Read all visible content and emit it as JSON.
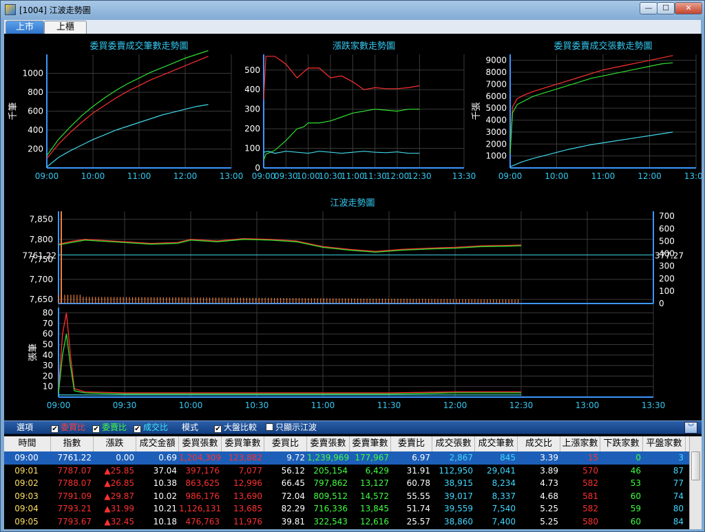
{
  "window": {
    "title": "[1004] 江波走勢圖",
    "min_label": "—",
    "max_label": "☐",
    "close_label": "✕"
  },
  "tabs": [
    {
      "label": "上市"
    },
    {
      "label": "上櫃"
    }
  ],
  "colors": {
    "red": "#ff3030",
    "green": "#30e030",
    "cyan": "#40d8e8",
    "axis": "#3c96ff",
    "title": "#34c8f0",
    "grid": "#3a3a3a",
    "orange": "#f0803a"
  },
  "chart_data": [
    {
      "type": "line",
      "title": "委買委賣成交筆數走勢圖",
      "ylabel": "千筆",
      "x_ticks": [
        "09:00",
        "10:00",
        "11:00",
        "12:00",
        "13:00"
      ],
      "ylim": [
        0,
        1200
      ],
      "y_ticks": [
        200,
        400,
        600,
        800,
        1000
      ],
      "series": [
        {
          "color": "green",
          "x": [
            0,
            0.25,
            0.5,
            0.75,
            1,
            1.25,
            1.5,
            1.75,
            2,
            2.25,
            2.5,
            2.75,
            3,
            3.25,
            3.5
          ],
          "y": [
            130,
            300,
            430,
            550,
            650,
            740,
            820,
            890,
            950,
            1010,
            1060,
            1110,
            1160,
            1200,
            1240
          ]
        },
        {
          "color": "red",
          "x": [
            0,
            0.25,
            0.5,
            0.75,
            1,
            1.25,
            1.5,
            1.75,
            2,
            2.25,
            2.5,
            2.75,
            3,
            3.25,
            3.5
          ],
          "y": [
            100,
            250,
            370,
            480,
            580,
            660,
            740,
            810,
            870,
            930,
            980,
            1030,
            1080,
            1130,
            1180
          ]
        },
        {
          "color": "cyan",
          "x": [
            0,
            0.25,
            0.5,
            0.75,
            1,
            1.25,
            1.5,
            1.75,
            2,
            2.25,
            2.5,
            2.75,
            3,
            3.25,
            3.5
          ],
          "y": [
            10,
            110,
            180,
            240,
            300,
            350,
            400,
            440,
            480,
            520,
            560,
            590,
            620,
            650,
            670
          ]
        }
      ]
    },
    {
      "type": "line",
      "title": "漲跌家數走勢圖",
      "x_ticks": [
        "09:00",
        "09:30",
        "10:00",
        "10:30",
        "11:00",
        "11:30",
        "12:00",
        "12:30",
        "13:30"
      ],
      "ylim": [
        0,
        580
      ],
      "y_ticks": [
        0,
        100,
        200,
        300,
        400,
        500
      ],
      "series": [
        {
          "color": "red",
          "x": [
            0,
            0.05,
            0.25,
            0.5,
            0.75,
            0.9,
            1,
            1.25,
            1.5,
            1.75,
            2,
            2.25,
            2.5,
            2.75,
            3,
            3.25,
            3.5
          ],
          "y": [
            350,
            570,
            570,
            530,
            460,
            490,
            510,
            510,
            460,
            470,
            440,
            400,
            410,
            405,
            405,
            410,
            420
          ]
        },
        {
          "color": "green",
          "x": [
            0,
            0.05,
            0.25,
            0.5,
            0.75,
            0.9,
            1,
            1.25,
            1.5,
            1.75,
            2,
            2.25,
            2.5,
            2.75,
            3,
            3.25,
            3.5
          ],
          "y": [
            40,
            70,
            90,
            140,
            200,
            210,
            230,
            230,
            240,
            260,
            280,
            290,
            300,
            295,
            290,
            300,
            300
          ]
        },
        {
          "color": "cyan",
          "x": [
            0,
            0.1,
            0.25,
            0.5,
            0.75,
            1,
            1.25,
            1.5,
            1.75,
            2,
            2.25,
            2.5,
            2.75,
            3,
            3.25,
            3.5
          ],
          "y": [
            80,
            85,
            75,
            85,
            80,
            75,
            85,
            80,
            75,
            80,
            85,
            80,
            78,
            82,
            75,
            75
          ]
        }
      ]
    },
    {
      "type": "line",
      "title": "委買委賣成交張數走勢圖",
      "ylabel": "千張",
      "x_ticks": [
        "09:00",
        "10:00",
        "11:00",
        "12:00",
        "13:00"
      ],
      "ylim": [
        0,
        9500
      ],
      "y_ticks": [
        1000,
        2000,
        3000,
        4000,
        5000,
        6000,
        7000,
        8000,
        9000
      ],
      "series": [
        {
          "color": "red",
          "x": [
            0,
            0.05,
            0.15,
            0.3,
            0.5,
            0.75,
            1,
            1.25,
            1.5,
            1.75,
            2,
            2.25,
            2.5,
            2.75,
            3,
            3.25,
            3.5
          ],
          "y": [
            1200,
            5100,
            5800,
            6100,
            6400,
            6700,
            7000,
            7300,
            7600,
            7900,
            8200,
            8400,
            8600,
            8800,
            9000,
            9200,
            9400
          ]
        },
        {
          "color": "green",
          "x": [
            0,
            0.05,
            0.15,
            0.3,
            0.5,
            0.75,
            1,
            1.25,
            1.5,
            1.75,
            2,
            2.25,
            2.5,
            2.75,
            3,
            3.25,
            3.5
          ],
          "y": [
            1200,
            4600,
            5300,
            5600,
            6000,
            6300,
            6600,
            6900,
            7200,
            7500,
            7700,
            7900,
            8100,
            8300,
            8500,
            8700,
            8800
          ]
        },
        {
          "color": "cyan",
          "x": [
            0,
            0.25,
            0.5,
            0.75,
            1,
            1.25,
            1.5,
            1.75,
            2,
            2.25,
            2.5,
            2.75,
            3,
            3.25,
            3.5
          ],
          "y": [
            100,
            500,
            800,
            1050,
            1300,
            1550,
            1750,
            1950,
            2100,
            2250,
            2400,
            2550,
            2700,
            2850,
            3000
          ]
        }
      ]
    },
    {
      "type": "line",
      "title": "江波走勢圖",
      "x_ticks": [
        "09:00",
        "09:30",
        "10:00",
        "10:30",
        "11:00",
        "11:30",
        "12:00",
        "12:30",
        "13:00",
        "13:30"
      ],
      "left_ylim": [
        7640,
        7870
      ],
      "left_ticks": [
        "7,650",
        "7,700",
        "7,750",
        "7,800",
        "7,850"
      ],
      "right_ylim": [
        0,
        740
      ],
      "right_ticks": [
        "0",
        "100",
        "200",
        "300",
        "400",
        "500",
        "600",
        "700"
      ],
      "ref_value": 7761.22,
      "ref_label": "7761.22",
      "ref_label_right": "377.27",
      "series": [
        {
          "color": "red",
          "x": [
            0,
            0.1,
            0.2,
            0.3,
            0.5,
            0.7,
            0.9,
            1,
            1.2,
            1.4,
            1.6,
            1.8,
            2,
            2.2,
            2.4,
            2.6,
            2.8,
            3,
            3.2,
            3.4,
            3.5
          ],
          "y": [
            7788,
            7795,
            7800,
            7798,
            7794,
            7790,
            7792,
            7800,
            7796,
            7802,
            7800,
            7796,
            7782,
            7775,
            7770,
            7775,
            7778,
            7780,
            7784,
            7785,
            7786
          ]
        },
        {
          "color": "green",
          "x": [
            0,
            0.1,
            0.2,
            0.3,
            0.5,
            0.7,
            0.9,
            1,
            1.2,
            1.4,
            1.6,
            1.8,
            2,
            2.2,
            2.4,
            2.6,
            2.8,
            3,
            3.2,
            3.4,
            3.5
          ],
          "y": [
            7786,
            7792,
            7798,
            7796,
            7792,
            7788,
            7790,
            7798,
            7794,
            7800,
            7798,
            7794,
            7780,
            7773,
            7768,
            7773,
            7776,
            7778,
            7782,
            7783,
            7784
          ]
        }
      ]
    },
    {
      "type": "line",
      "title": "",
      "ylabel": "張筆",
      "x_ticks": [
        "09:00",
        "09:30",
        "10:00",
        "10:30",
        "11:00",
        "11:30",
        "12:00",
        "12:30",
        "13:00",
        "13:30"
      ],
      "ylim": [
        0,
        85
      ],
      "y_ticks": [
        10,
        20,
        30,
        40,
        50,
        60,
        70,
        80
      ],
      "series": [
        {
          "color": "red",
          "x": [
            0,
            0.03,
            0.06,
            0.09,
            0.12,
            0.2,
            0.5,
            1,
            1.5,
            2,
            2.5,
            3,
            3.5
          ],
          "y": [
            5,
            60,
            80,
            40,
            8,
            5,
            4,
            4,
            4,
            4,
            4,
            5,
            5
          ]
        },
        {
          "color": "green",
          "x": [
            0,
            0.03,
            0.06,
            0.09,
            0.12,
            0.2,
            0.5,
            1,
            1.5,
            2,
            2.5,
            3,
            3.5
          ],
          "y": [
            4,
            40,
            60,
            30,
            6,
            4,
            3,
            3,
            3,
            3,
            3,
            4,
            4
          ]
        },
        {
          "color": "cyan",
          "x": [
            0,
            0.5,
            1,
            1.5,
            2,
            2.5,
            3,
            3.5
          ],
          "y": [
            2,
            2,
            2,
            2,
            2,
            2,
            2,
            2
          ]
        }
      ]
    }
  ],
  "options": {
    "label": "選項",
    "mode_label": "模式",
    "checks": [
      {
        "label": "委買比",
        "checked": "✔"
      },
      {
        "label": "委賣比",
        "checked": "✔"
      },
      {
        "label": "成交比",
        "checked": "✔"
      },
      {
        "label": "大盤比較",
        "checked": "✔"
      },
      {
        "label": "只顯示江波",
        "checked": ""
      }
    ]
  },
  "table": {
    "headers": [
      "時間",
      "指數",
      "漲跌",
      "成交金額",
      "委買張數",
      "委買筆數",
      "委買比",
      "委賣張數",
      "委賣筆數",
      "委賣比",
      "成交張數",
      "成交筆數",
      "成交比",
      "上漲家數",
      "下跌家數",
      "平盤家數"
    ],
    "rows": [
      [
        "09:00",
        "7761.22",
        "0.00",
        "0.69",
        "1,204,309",
        "123,882",
        "9.72",
        "1,239,969",
        "177,967",
        "6.97",
        "2,867",
        "845",
        "3.39",
        "15",
        "0",
        "3"
      ],
      [
        "09:01",
        "7787.07",
        "▲25.85",
        "37.04",
        "397,176",
        "7,077",
        "56.12",
        "205,154",
        "6,429",
        "31.91",
        "112,950",
        "29,041",
        "3.89",
        "570",
        "46",
        "87"
      ],
      [
        "09:02",
        "7788.07",
        "▲26.85",
        "10.38",
        "863,625",
        "12,996",
        "66.45",
        "797,862",
        "13,127",
        "60.78",
        "38,915",
        "8,234",
        "4.73",
        "582",
        "53",
        "77"
      ],
      [
        "09:03",
        "7791.09",
        "▲29.87",
        "10.02",
        "986,176",
        "13,690",
        "72.04",
        "809,512",
        "14,572",
        "55.55",
        "39,017",
        "8,337",
        "4.68",
        "581",
        "60",
        "74"
      ],
      [
        "09:04",
        "7793.21",
        "▲31.99",
        "10.21",
        "1,126,131",
        "13,685",
        "82.29",
        "716,336",
        "13,845",
        "51.74",
        "39,559",
        "7,540",
        "5.25",
        "582",
        "59",
        "80"
      ],
      [
        "09:05",
        "7793.67",
        "▲32.45",
        "10.18",
        "476,763",
        "11,976",
        "39.81",
        "322,543",
        "12,616",
        "25.57",
        "38,860",
        "7,400",
        "5.25",
        "580",
        "60",
        "84"
      ]
    ]
  }
}
